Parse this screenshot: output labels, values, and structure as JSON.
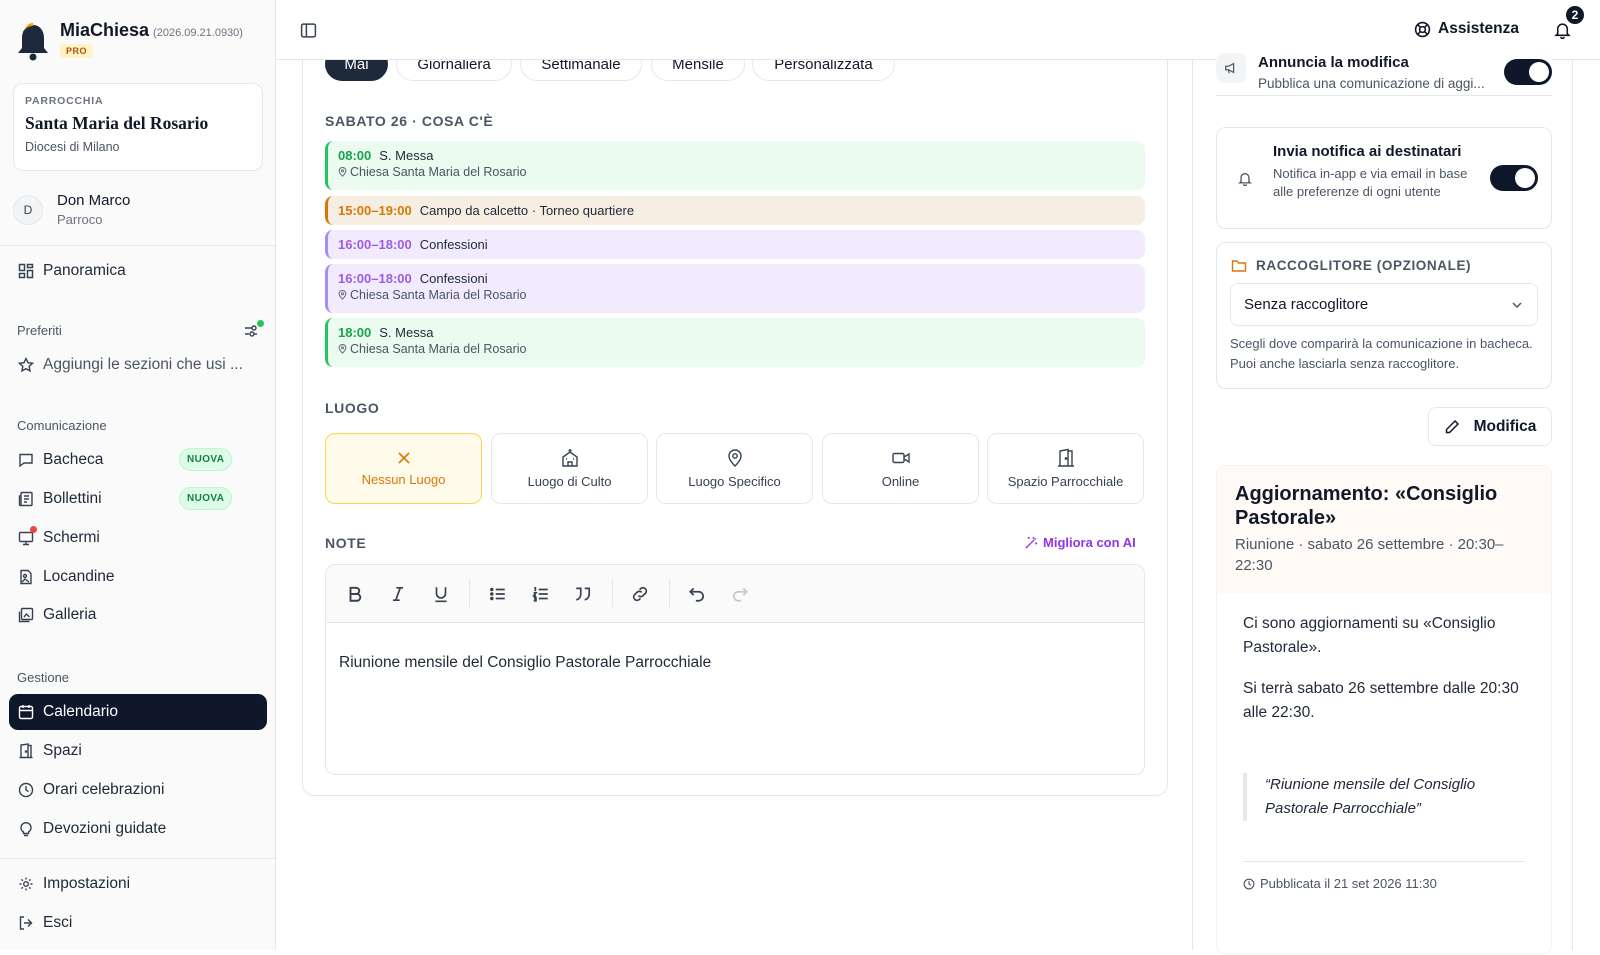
{
  "sidebar": {
    "app_name": "MiaChiesa",
    "version": "(2026.09.21.0930)",
    "plan_badge": "PRO",
    "parish": {
      "label": "PARROCCHIA",
      "name": "Santa Maria del Rosario",
      "diocese": "Diocesi di Milano"
    },
    "user": {
      "initial": "D",
      "name": "Don Marco",
      "role": "Parroco"
    },
    "overview": "Panoramica",
    "favorites_title": "Preferiti",
    "favorites_hint": "Aggiungi le sezioni che usi ...",
    "communication_title": "Comunicazione",
    "communication": [
      {
        "label": "Bacheca",
        "badge": "NUOVA"
      },
      {
        "label": "Bollettini",
        "badge": "NUOVA"
      },
      {
        "label": "Schermi"
      },
      {
        "label": "Locandine"
      },
      {
        "label": "Galleria"
      }
    ],
    "management_title": "Gestione",
    "management": [
      {
        "label": "Calendario"
      },
      {
        "label": "Spazi"
      },
      {
        "label": "Orari celebrazioni"
      },
      {
        "label": "Devozioni guidate"
      }
    ],
    "settings": "Impostazioni",
    "logout": "Esci"
  },
  "topbar": {
    "help": "Assistenza",
    "notifications_count": "2"
  },
  "recurrence": {
    "options": [
      "Mai",
      "Giornaliera",
      "Settimanale",
      "Mensile",
      "Personalizzata"
    ],
    "selected": "Mai"
  },
  "day": {
    "header": "SABATO 26 · COSA C'È",
    "events": [
      {
        "time": "08:00",
        "title": "S. Messa",
        "location": "Chiesa Santa Maria del Rosario",
        "color": "green"
      },
      {
        "time": "15:00–19:00",
        "title": "Campo da calcetto · Torneo quartiere",
        "color": "amber"
      },
      {
        "time": "16:00–18:00",
        "title": "Confessioni",
        "color": "purple"
      },
      {
        "time": "16:00–18:00",
        "title": "Confessioni",
        "location": "Chiesa Santa Maria del Rosario",
        "color": "purple"
      },
      {
        "time": "18:00",
        "title": "S. Messa",
        "location": "Chiesa Santa Maria del Rosario",
        "color": "green"
      }
    ]
  },
  "place": {
    "header": "LUOGO",
    "options": [
      "Nessun Luogo",
      "Luogo di Culto",
      "Luogo Specifico",
      "Online",
      "Spazio Parrocchiale"
    ],
    "selected": "Nessun Luogo"
  },
  "notes": {
    "header": "NOTE",
    "ai_button": "Migliora con AI",
    "content": "Riunione mensile del Consiglio Pastorale Parrocchiale"
  },
  "right": {
    "announce": {
      "title": "Annuncia la modifica",
      "subtitle": "Pubblica una comunicazione di aggi...",
      "enabled": true
    },
    "notify": {
      "title": "Invia notifica ai destinatari",
      "subtitle": "Notifica in-app e via email in base alle preferenze di ogni utente",
      "enabled": true
    },
    "folder": {
      "title": "RACCOGLITORE (OPZIONALE)",
      "selected": "Senza raccoglitore",
      "help": "Scegli dove comparirà la comunicazione in bacheca. Puoi anche lasciarla senza raccoglitore."
    },
    "edit_button": "Modifica",
    "preview": {
      "title": "Aggiornamento: «Consiglio Pastorale»",
      "meta": "Riunione · sabato 26 settembre · 20:30–22:30",
      "p1": "Ci sono aggiornamenti su «Consiglio Pastorale».",
      "p2": "Si terrà sabato 26 settembre dalle 20:30 alle 22:30.",
      "quote": "“Riunione mensile del Consiglio Pastorale Parrocchiale”",
      "published": "Pubblicata il 21 set 2026 11:30"
    }
  },
  "colors": {
    "accent": "#0f172a",
    "green": "#16a34a",
    "amber": "#d97706",
    "purple": "#9b5de5",
    "ai": "#9333ea"
  }
}
